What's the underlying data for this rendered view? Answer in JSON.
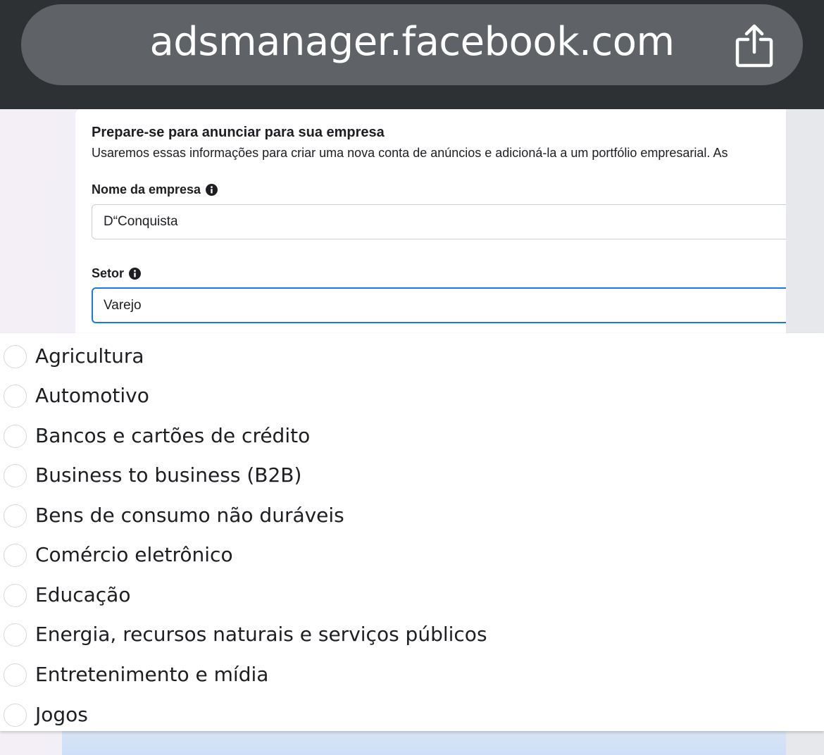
{
  "browser": {
    "url": "adsmanager.facebook.com",
    "share_icon": "share-icon"
  },
  "form": {
    "title": "Prepare-se para anunciar para sua empresa",
    "description": "Usaremos essas informações para criar uma nova conta de anúncios e adicioná-la a um portfólio empresarial. As",
    "company_label": "Nome da empresa",
    "company_value": "D“Conquista",
    "sector_label": "Setor",
    "sector_value": "Varejo",
    "info_icon": "info-icon"
  },
  "options": [
    {
      "label": "Agricultura",
      "selected": false
    },
    {
      "label": "Automotivo",
      "selected": false
    },
    {
      "label": "Bancos e cartões de crédito",
      "selected": false
    },
    {
      "label": "Business to business (B2B)",
      "selected": false
    },
    {
      "label": "Bens de consumo não duráveis",
      "selected": false
    },
    {
      "label": "Comércio eletrônico",
      "selected": false
    },
    {
      "label": "Educação",
      "selected": false
    },
    {
      "label": "Energia, recursos naturais e serviços públicos",
      "selected": false
    },
    {
      "label": "Entretenimento e mídia",
      "selected": false
    },
    {
      "label": "Jogos",
      "selected": false
    }
  ],
  "colors": {
    "browser_bar": "#2e3134",
    "url_pill": "#5f6367",
    "focus_border": "#1877f2",
    "text": "#1c1e21"
  }
}
